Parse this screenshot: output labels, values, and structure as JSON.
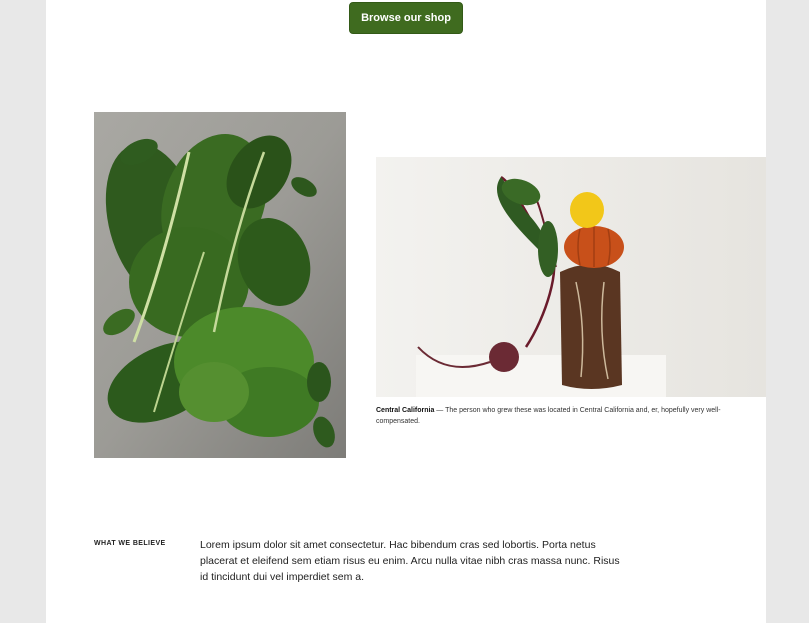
{
  "cta": {
    "label": "Browse our shop"
  },
  "caption": {
    "title": "Central California",
    "text": " — The person who grew these was located in Central California and, er, hopefully very well-compensated."
  },
  "believe": {
    "label": "WHAT WE BELIEVE",
    "text": "Lorem ipsum dolor sit amet consectetur. Hac bibendum cras sed lobortis. Porta netus placerat et eleifend sem etiam risus eu enim. Arcu nulla vitae nibh cras massa nunc. Risus id tincidunt dui vel imperdiet sem a."
  },
  "colors": {
    "accent": "#3f6b1f"
  }
}
